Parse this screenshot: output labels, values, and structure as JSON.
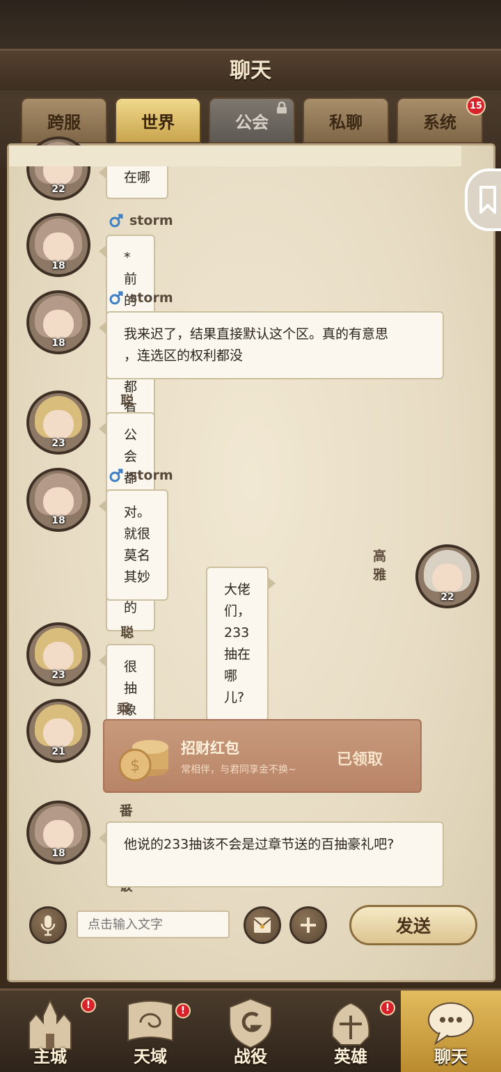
{
  "header": {
    "title": "聊天"
  },
  "tabs": [
    {
      "label": "跨服"
    },
    {
      "label": "世界"
    },
    {
      "label": "公会"
    },
    {
      "label": "私聊"
    },
    {
      "label": "系统",
      "badge": "15"
    }
  ],
  "messages": [
    {
      "level": "22",
      "text": "在哪"
    },
    {
      "gender": "male",
      "name": "storm",
      "level": "18",
      "text": "*前的几个区都有"
    },
    {
      "gender": "male",
      "name": "storm",
      "level": "18",
      "line1": "我来迟了，结果直接默认这个区。真的有意思",
      "line2": "，连选区的权利都没"
    },
    {
      "gender": "female",
      "name": "聪颖娜琪",
      "level": "23",
      "text": "公会都是指定的加的"
    },
    {
      "gender": "male",
      "name": "storm",
      "level": "18",
      "text": "对。就很莫名其妙"
    },
    {
      "name": "高雅",
      "level": "22",
      "text": "大佬们，233抽在哪儿?"
    },
    {
      "gender": "female",
      "name": "聪颖娜琪",
      "level": "23",
      "text": "很抽象"
    },
    {
      "gender": "female",
      "name": "乘务员阿咩",
      "level": "21",
      "packet_title": "招财红包",
      "packet_subtitle": "常相伴，与君同享金不换~",
      "packet_status": "已领取"
    },
    {
      "gender": "male",
      "name": "番茄牛腩饭",
      "level": "18",
      "text": "他说的233抽该不会是过章节送的百抽豪礼吧?"
    }
  ],
  "input": {
    "placeholder": "点击输入文字",
    "send_label": "发送"
  },
  "nav": [
    {
      "label": "主城",
      "alert": "!"
    },
    {
      "label": "天域",
      "alert": "!"
    },
    {
      "label": "战役"
    },
    {
      "label": "英雄",
      "alert": "!"
    },
    {
      "label": "聊天"
    }
  ],
  "colors": {
    "male": "#3f7fc4",
    "female": "#b54ca8",
    "accent": "#d7222c"
  }
}
